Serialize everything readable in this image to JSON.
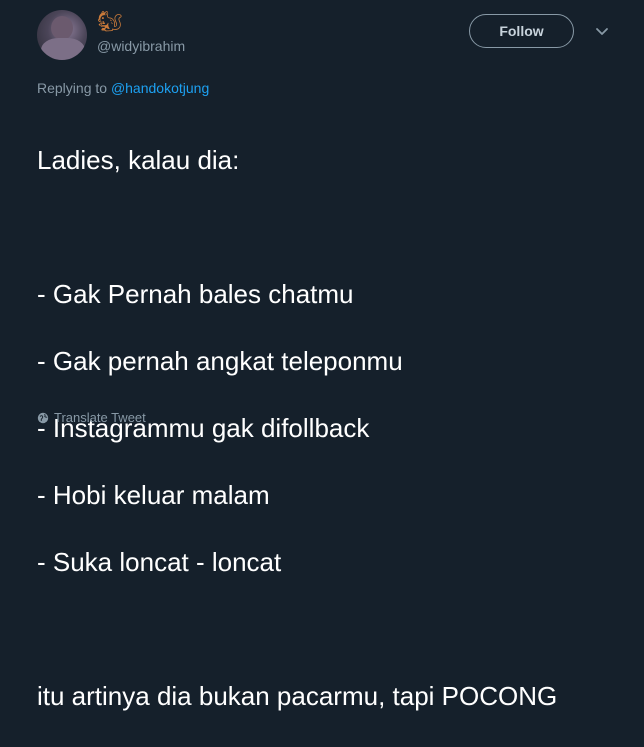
{
  "user": {
    "emoji": "🐿",
    "handle": "@widyibrahim"
  },
  "header": {
    "follow_label": "Follow"
  },
  "reply": {
    "prefix": "Replying to ",
    "mention": "@handokotjung"
  },
  "tweet": {
    "lines": [
      "Ladies, kalau dia:",
      "",
      "- Gak Pernah bales chatmu",
      "- Gak pernah angkat teleponmu",
      "- Instagrammu gak difollback",
      "- Hobi keluar malam",
      "- Suka loncat - loncat",
      "",
      "itu artinya dia bukan pacarmu, tapi POCONG"
    ]
  },
  "footer": {
    "translate_label": "Translate Tweet"
  },
  "colors": {
    "background": "#15202b",
    "secondary_text": "#8899a6",
    "link": "#1da1f2"
  }
}
